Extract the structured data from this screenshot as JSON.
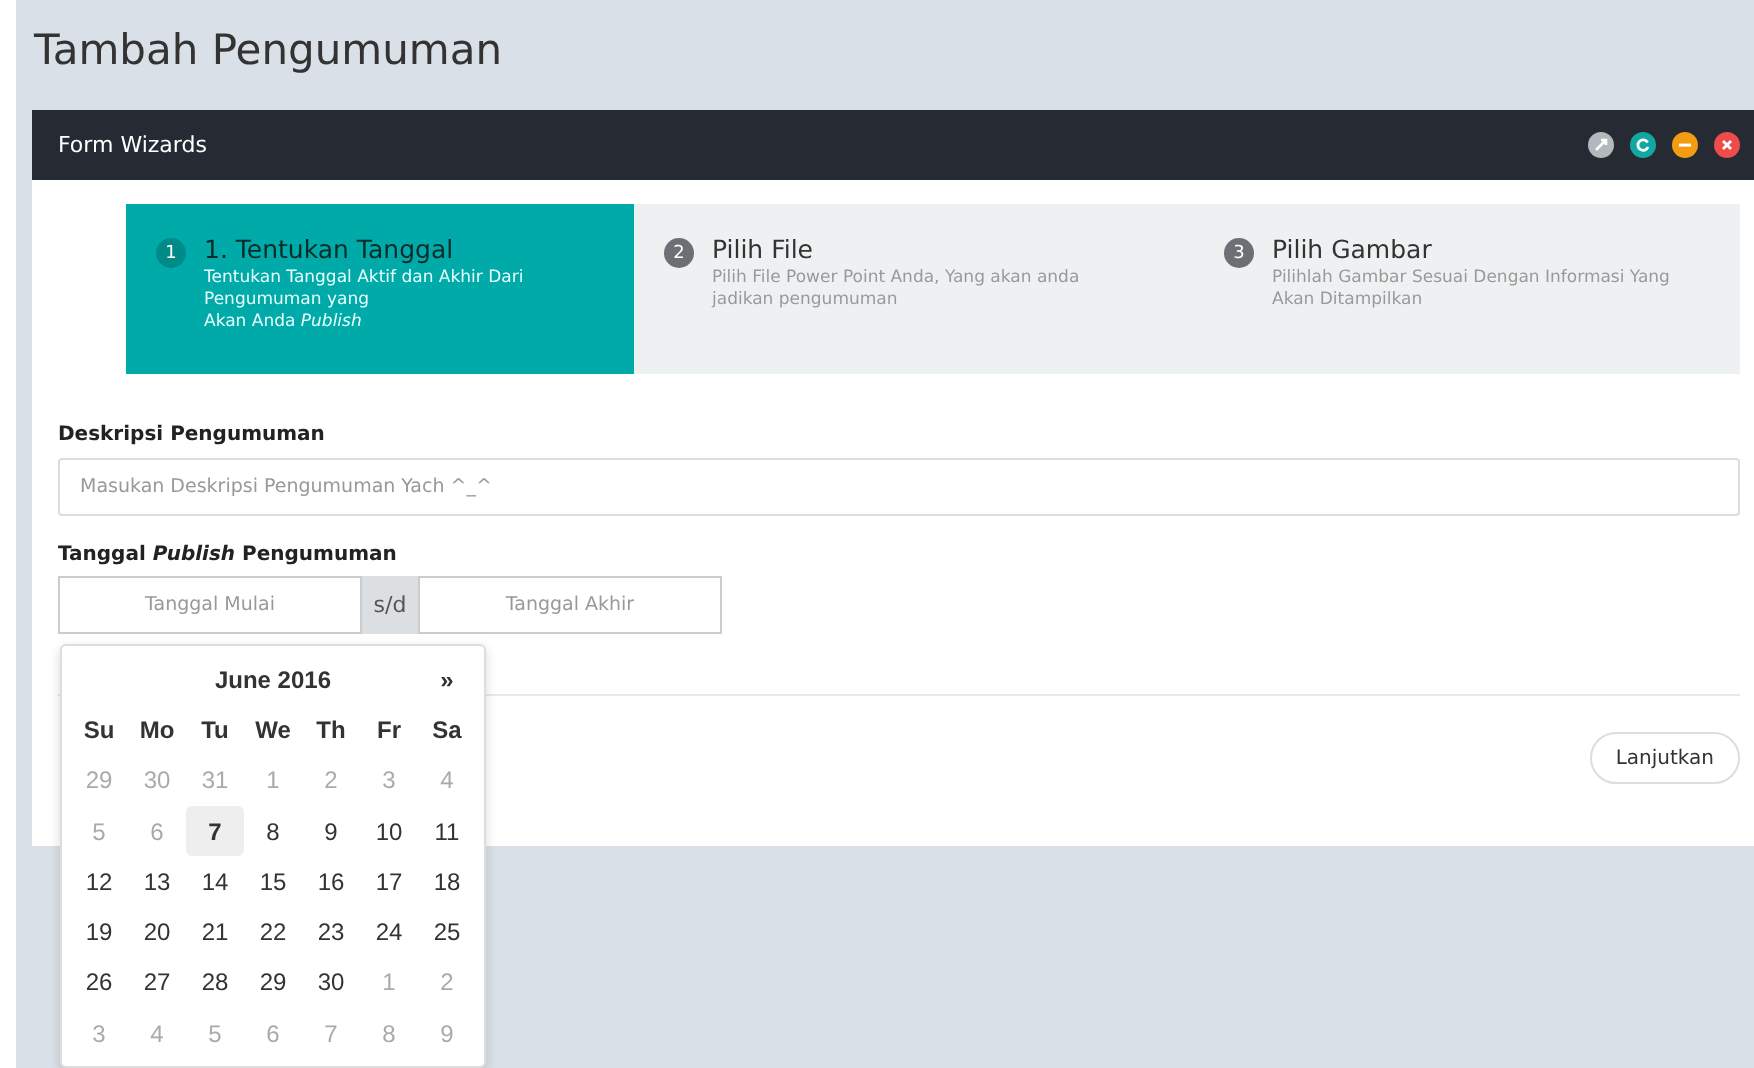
{
  "page_title": "Tambah Pengumuman",
  "panel": {
    "title": "Form Wizards"
  },
  "steps": [
    {
      "number": "1",
      "title": "1. Tentukan Tanggal",
      "description_lines": [
        "Tentukan Tanggal Aktif dan Akhir Dari Pengumuman yang",
        "Akan Anda *Publish*"
      ],
      "selected": true
    },
    {
      "number": "2",
      "title": "Pilih File",
      "description_lines": [
        "Pilih File Power Point Anda, Yang akan anda jadikan pengumuman"
      ],
      "selected": false
    },
    {
      "number": "3",
      "title": "Pilih Gambar",
      "description_lines": [
        "Pilihlah Gambar Sesuai Dengan Informasi Yang Akan Ditampilkan"
      ],
      "selected": false
    }
  ],
  "description_field": {
    "label": "Deskripsi Pengumuman",
    "placeholder": "Masukan Deskripsi Pengumuman Yach ^_^"
  },
  "date_range": {
    "label": "Tanggal *Publish* Pengumuman",
    "start_placeholder": "Tanggal Mulai",
    "separator": "s/d",
    "end_placeholder": "Tanggal Akhir"
  },
  "next_button": "Lanjutkan",
  "calendar": {
    "month": "June 2016",
    "next": "»",
    "weekdays": [
      "Su",
      "Mo",
      "Tu",
      "We",
      "Th",
      "Fr",
      "Sa"
    ],
    "days": [
      {
        "label": "29",
        "muted": true,
        "selected": false
      },
      {
        "label": "30",
        "muted": true,
        "selected": false
      },
      {
        "label": "31",
        "muted": true,
        "selected": false
      },
      {
        "label": "1",
        "muted": true,
        "selected": false
      },
      {
        "label": "2",
        "muted": true,
        "selected": false
      },
      {
        "label": "3",
        "muted": true,
        "selected": false
      },
      {
        "label": "4",
        "muted": true,
        "selected": false
      },
      {
        "label": "5",
        "muted": true,
        "selected": false
      },
      {
        "label": "6",
        "muted": true,
        "selected": false
      },
      {
        "label": "7",
        "muted": false,
        "selected": true
      },
      {
        "label": "8",
        "muted": false,
        "selected": false
      },
      {
        "label": "9",
        "muted": false,
        "selected": false
      },
      {
        "label": "10",
        "muted": false,
        "selected": false
      },
      {
        "label": "11",
        "muted": false,
        "selected": false
      },
      {
        "label": "12",
        "muted": false,
        "selected": false
      },
      {
        "label": "13",
        "muted": false,
        "selected": false
      },
      {
        "label": "14",
        "muted": false,
        "selected": false
      },
      {
        "label": "15",
        "muted": false,
        "selected": false
      },
      {
        "label": "16",
        "muted": false,
        "selected": false
      },
      {
        "label": "17",
        "muted": false,
        "selected": false
      },
      {
        "label": "18",
        "muted": false,
        "selected": false
      },
      {
        "label": "19",
        "muted": false,
        "selected": false
      },
      {
        "label": "20",
        "muted": false,
        "selected": false
      },
      {
        "label": "21",
        "muted": false,
        "selected": false
      },
      {
        "label": "22",
        "muted": false,
        "selected": false
      },
      {
        "label": "23",
        "muted": false,
        "selected": false
      },
      {
        "label": "24",
        "muted": false,
        "selected": false
      },
      {
        "label": "25",
        "muted": false,
        "selected": false
      },
      {
        "label": "26",
        "muted": false,
        "selected": false
      },
      {
        "label": "27",
        "muted": false,
        "selected": false
      },
      {
        "label": "28",
        "muted": false,
        "selected": false
      },
      {
        "label": "29",
        "muted": false,
        "selected": false
      },
      {
        "label": "30",
        "muted": false,
        "selected": false
      },
      {
        "label": "1",
        "muted": true,
        "selected": false
      },
      {
        "label": "2",
        "muted": true,
        "selected": false
      },
      {
        "label": "3",
        "muted": true,
        "selected": false
      },
      {
        "label": "4",
        "muted": true,
        "selected": false
      },
      {
        "label": "5",
        "muted": true,
        "selected": false
      },
      {
        "label": "6",
        "muted": true,
        "selected": false
      },
      {
        "label": "7",
        "muted": true,
        "selected": false
      },
      {
        "label": "8",
        "muted": true,
        "selected": false
      },
      {
        "label": "9",
        "muted": true,
        "selected": false
      }
    ]
  }
}
